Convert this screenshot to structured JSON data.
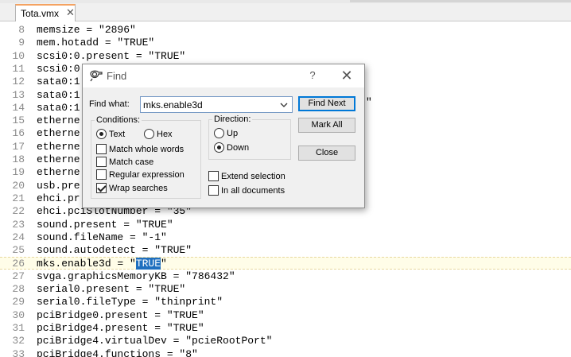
{
  "tab": {
    "label": "Tota.vmx",
    "close": "✕"
  },
  "lines": [
    {
      "n": "8",
      "code": "memsize = \"2896\""
    },
    {
      "n": "9",
      "code": "mem.hotadd = \"TRUE\""
    },
    {
      "n": "10",
      "code": "scsi0:0.present = \"TRUE\""
    },
    {
      "n": "11",
      "code": "scsi0:0"
    },
    {
      "n": "12",
      "code": "sata0:1"
    },
    {
      "n": "13",
      "code": "sata0:1"
    },
    {
      "n": "14",
      "code": "sata0:1"
    },
    {
      "n": "15",
      "code": "etherne"
    },
    {
      "n": "16",
      "code": "etherne"
    },
    {
      "n": "17",
      "code": "etherne"
    },
    {
      "n": "18",
      "code": "etherne"
    },
    {
      "n": "19",
      "code": "etherne"
    },
    {
      "n": "20",
      "code": "usb.pre"
    },
    {
      "n": "21",
      "code": "ehci.pr"
    },
    {
      "n": "22",
      "code": "ehci.pciSlotNumber = \"35\""
    },
    {
      "n": "23",
      "code": "sound.present = \"TRUE\""
    },
    {
      "n": "24",
      "code": "sound.fileName = \"-1\""
    },
    {
      "n": "25",
      "code": "sound.autodetect = \"TRUE\""
    },
    {
      "n": "26",
      "code_before": "mks.enable3d = \"",
      "code_sel": "TRUE",
      "code_after": "\""
    },
    {
      "n": "27",
      "code": "svga.graphicsMemoryKB = \"786432\""
    },
    {
      "n": "28",
      "code": "serial0.present = \"TRUE\""
    },
    {
      "n": "29",
      "code": "serial0.fileType = \"thinprint\""
    },
    {
      "n": "30",
      "code": "pciBridge0.present = \"TRUE\""
    },
    {
      "n": "31",
      "code": "pciBridge4.present = \"TRUE\""
    },
    {
      "n": "32",
      "code": "pciBridge4.virtualDev = \"pcieRootPort\""
    },
    {
      "n": "33",
      "code": "pciBridge4.functions = \"8\""
    }
  ],
  "partial_right": {
    "r13": "\""
  },
  "dialog": {
    "title": "Find",
    "help": "?",
    "close": "✕",
    "find_what_label": "Find what:",
    "find_value": "mks.enable3d",
    "buttons": {
      "find_next": "Find Next",
      "mark_all": "Mark All",
      "close": "Close"
    },
    "conditions": {
      "title": "Conditions:",
      "text": "Text",
      "hex": "Hex",
      "match_whole_words": "Match whole words",
      "match_case": "Match case",
      "regular_expression": "Regular expression",
      "wrap_searches": "Wrap searches"
    },
    "direction": {
      "title": "Direction:",
      "up": "Up",
      "down": "Down"
    },
    "extend_selection": "Extend selection",
    "in_all_documents": "In all documents"
  },
  "colors": {
    "selection": "#1f6fbf",
    "tab_accent": "#f4a261",
    "line_number": "#8a8a8a"
  }
}
